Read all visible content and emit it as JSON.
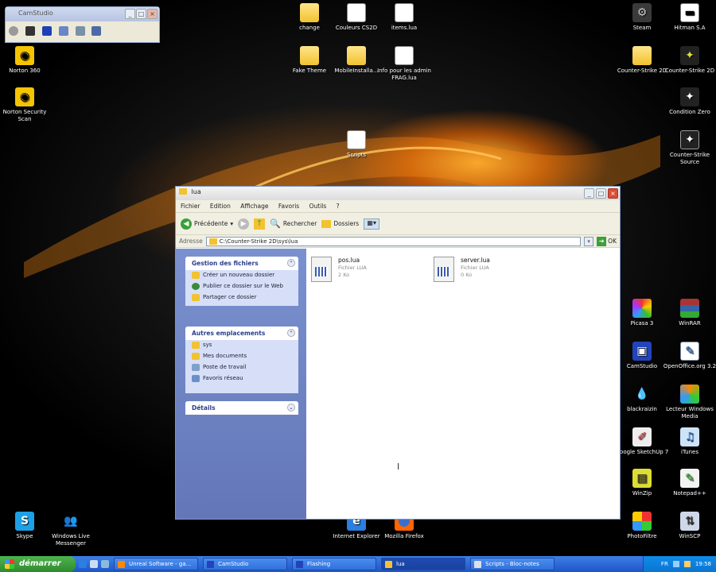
{
  "camstudio": {
    "title": "CamStudio"
  },
  "desktop_icons": [
    {
      "label": "Norton 360"
    },
    {
      "label": "Norton Security Scan"
    },
    {
      "label": "change"
    },
    {
      "label": "Couleurs CS2D"
    },
    {
      "label": "items.lua"
    },
    {
      "label": "Fake Theme"
    },
    {
      "label": "MobileInstalla..."
    },
    {
      "label": "Info pour les admin FRAG.lua"
    },
    {
      "label": "Scripts"
    },
    {
      "label": "Steam"
    },
    {
      "label": "Hitman S.A"
    },
    {
      "label": "Counter-Strike 2D"
    },
    {
      "label": "Counter-Strike 2D"
    },
    {
      "label": "Condition Zero"
    },
    {
      "label": "Counter-Strike Source"
    },
    {
      "label": "Picasa 3"
    },
    {
      "label": "WinRAR"
    },
    {
      "label": "CamStudio"
    },
    {
      "label": "OpenOffice.org 3.2"
    },
    {
      "label": "blackraizin"
    },
    {
      "label": "Lecteur Windows Media"
    },
    {
      "label": "Google SketchUp 7"
    },
    {
      "label": "iTunes"
    },
    {
      "label": "WinZip"
    },
    {
      "label": "Notepad++"
    },
    {
      "label": "PhotoFiltre"
    },
    {
      "label": "WinSCP"
    },
    {
      "label": "Skype"
    },
    {
      "label": "Windows Live Messenger"
    },
    {
      "label": "Internet Explorer"
    },
    {
      "label": "Mozilla Firefox"
    }
  ],
  "explorer": {
    "title": "lua",
    "menu": [
      "Fichier",
      "Edition",
      "Affichage",
      "Favoris",
      "Outils",
      "?"
    ],
    "toolbar": {
      "back": "Précédente",
      "search": "Rechercher",
      "folders": "Dossiers"
    },
    "address_label": "Adresse",
    "address_value": "C:\\Counter-Strike 2D\\sys\\lua",
    "go_label": "OK",
    "panels": [
      {
        "title": "Gestion des fichiers",
        "items": [
          "Créer un nouveau dossier",
          "Publier ce dossier sur le Web",
          "Partager ce dossier"
        ]
      },
      {
        "title": "Autres emplacements",
        "items": [
          "sys",
          "Mes documents",
          "Poste de travail",
          "Favoris réseau"
        ]
      },
      {
        "title": "Détails",
        "items": []
      }
    ],
    "files": [
      {
        "name": "pos.lua",
        "type": "Fichier LUA",
        "size": "2 Ko"
      },
      {
        "name": "server.lua",
        "type": "Fichier LUA",
        "size": "0 Ko"
      }
    ]
  },
  "taskbar": {
    "start_label": "démarrer",
    "tasks": [
      "Unreal Software - ga...",
      "CamStudio",
      "Flashing",
      "lua",
      "Scripts - Bloc-notes"
    ],
    "lang": "FR",
    "clock": "19:58"
  }
}
